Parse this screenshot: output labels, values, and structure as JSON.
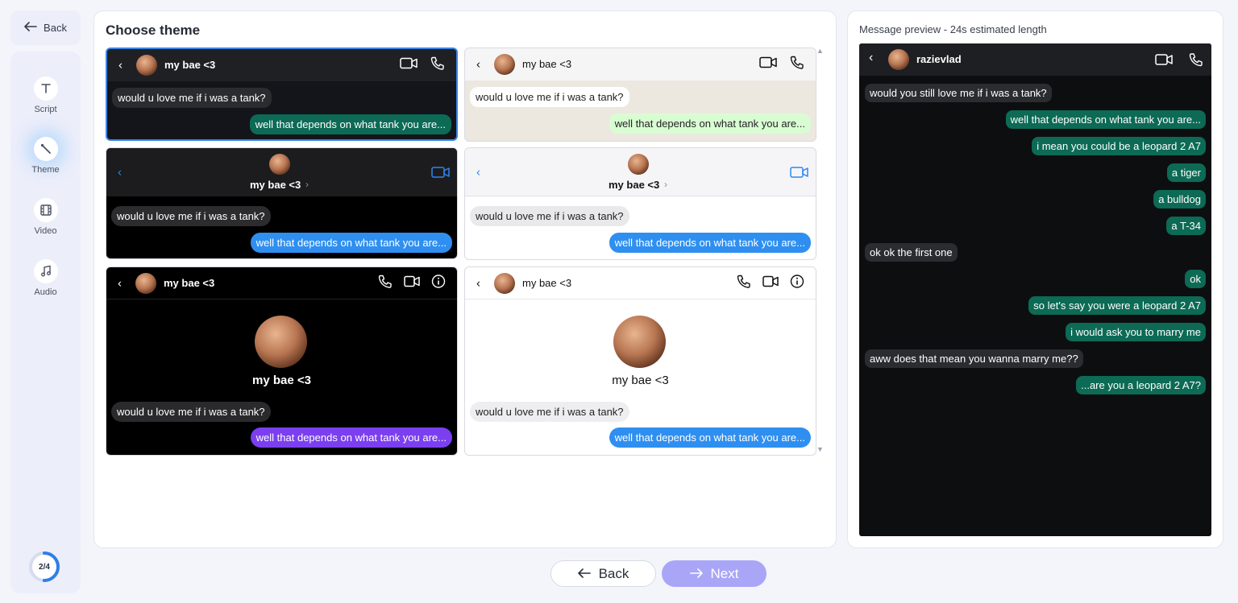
{
  "nav": {
    "back_label": "Back",
    "items": [
      {
        "label": "Script"
      },
      {
        "label": "Theme"
      },
      {
        "label": "Video"
      },
      {
        "label": "Audio"
      }
    ],
    "progress_label": "2/4",
    "progress_fraction": 0.5
  },
  "main": {
    "title": "Choose theme",
    "themes": [
      {
        "name": "my bae <3",
        "in_msg": "would u love me if i was a tank?",
        "out_msg": "well that depends on what tank you are..."
      },
      {
        "name": "my bae <3",
        "in_msg": "would u love me if i was a tank?",
        "out_msg": "well that depends on what tank you are..."
      },
      {
        "name": "my bae <3",
        "in_msg": "would u love me if i was a tank?",
        "out_msg": "well that depends on what tank you are..."
      },
      {
        "name": "my bae <3",
        "in_msg": "would u love me if i was a tank?",
        "out_msg": "well that depends on what tank you are..."
      },
      {
        "name": "my bae <3",
        "profile_name": "my bae <3",
        "in_msg": "would u love me if i was a tank?",
        "out_msg": "well that depends on what tank you are..."
      },
      {
        "name": "my bae <3",
        "profile_name": "my bae <3",
        "in_msg": "would u love me if i was a tank?",
        "out_msg": "well that depends on what tank you are..."
      }
    ]
  },
  "preview": {
    "title": "Message preview - 24s estimated length",
    "contact": "razievlad",
    "messages": [
      {
        "dir": "in",
        "text": "would you still love me if i was a tank?"
      },
      {
        "dir": "out",
        "text": "well that depends on what tank you are..."
      },
      {
        "dir": "out",
        "text": "i mean you could be a leopard 2 A7"
      },
      {
        "dir": "out",
        "text": "a tiger"
      },
      {
        "dir": "out",
        "text": "a bulldog"
      },
      {
        "dir": "out",
        "text": "a T-34"
      },
      {
        "dir": "in",
        "text": "ok ok the first one"
      },
      {
        "dir": "out",
        "text": "ok"
      },
      {
        "dir": "out",
        "text": "so let's say you were a leopard 2 A7"
      },
      {
        "dir": "out",
        "text": "i would ask you to marry me"
      },
      {
        "dir": "in",
        "text": "aww does that mean you wanna marry me??"
      },
      {
        "dir": "out",
        "text": "...are you a leopard 2 A7?"
      }
    ]
  },
  "footer": {
    "back_label": "Back",
    "next_label": "Next"
  }
}
